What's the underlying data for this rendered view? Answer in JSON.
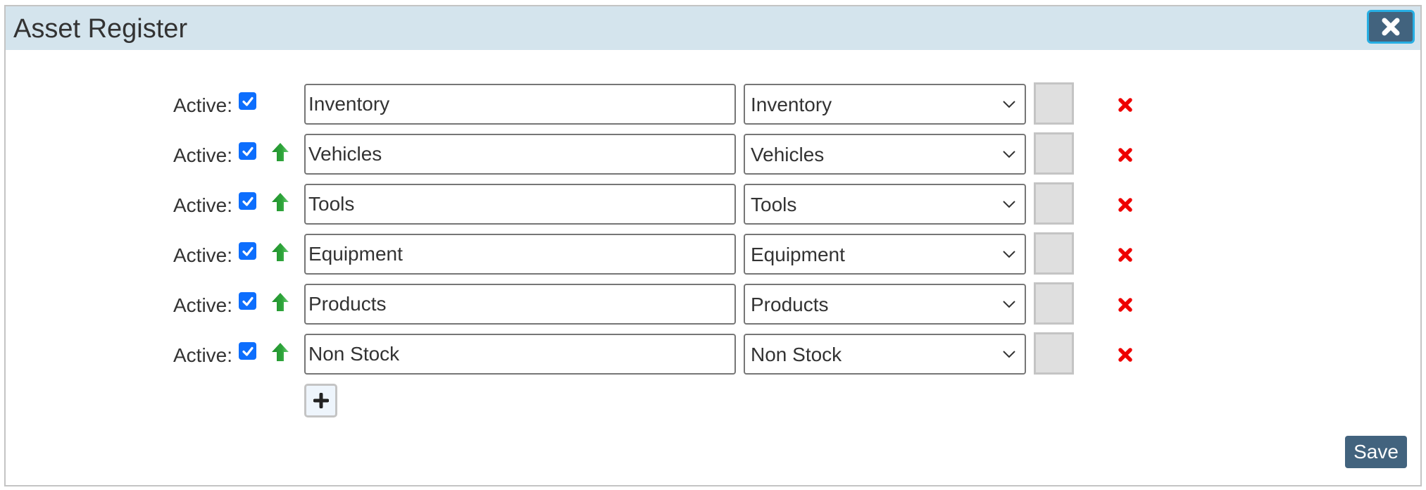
{
  "dialog": {
    "title": "Asset Register",
    "close_icon": "close-icon"
  },
  "rows": [
    {
      "active_label": "Active:",
      "active": true,
      "show_move_up": false,
      "name": "Inventory",
      "type": "Inventory"
    },
    {
      "active_label": "Active:",
      "active": true,
      "show_move_up": true,
      "name": "Vehicles",
      "type": "Vehicles"
    },
    {
      "active_label": "Active:",
      "active": true,
      "show_move_up": true,
      "name": "Tools",
      "type": "Tools"
    },
    {
      "active_label": "Active:",
      "active": true,
      "show_move_up": true,
      "name": "Equipment",
      "type": "Equipment"
    },
    {
      "active_label": "Active:",
      "active": true,
      "show_move_up": true,
      "name": "Products",
      "type": "Products"
    },
    {
      "active_label": "Active:",
      "active": true,
      "show_move_up": true,
      "name": "Non Stock",
      "type": "Non Stock"
    }
  ],
  "icons": {
    "checkbox": "checkbox-checked-icon",
    "move_up": "arrow-up-icon",
    "delete": "delete-x-icon",
    "add": "plus-icon",
    "dropdown": "chevron-down-icon"
  },
  "colors": {
    "header_bg": "#d4e4ed",
    "button_bg": "#42637e",
    "close_border": "#27aee3",
    "checkbox": "#0d6efd",
    "arrow": "#2ea43a",
    "delete": "#ee0000"
  },
  "footer": {
    "save_label": "Save"
  }
}
